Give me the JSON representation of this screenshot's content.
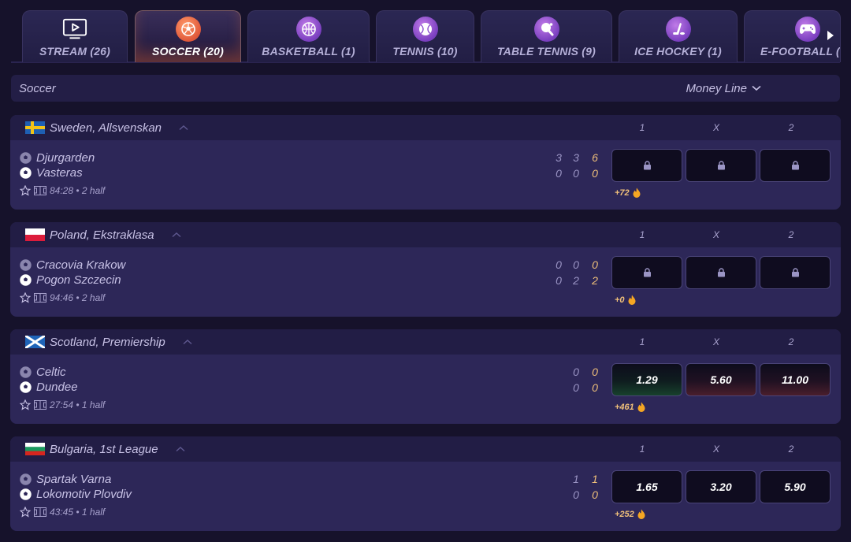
{
  "tabs": [
    {
      "label": "STREAM (26)",
      "icon": "stream-icon",
      "active": false
    },
    {
      "label": "SOCCER (20)",
      "icon": "soccer-ball-icon",
      "active": true
    },
    {
      "label": "BASKETBALL (1)",
      "icon": "basketball-icon",
      "active": false
    },
    {
      "label": "TENNIS (10)",
      "icon": "tennis-ball-icon",
      "active": false
    },
    {
      "label": "TABLE TENNIS (9)",
      "icon": "table-tennis-icon",
      "active": false
    },
    {
      "label": "ICE HOCKEY (1)",
      "icon": "ice-hockey-icon",
      "active": false
    },
    {
      "label": "E-FOOTBALL (",
      "icon": "gamepad-icon",
      "active": false
    }
  ],
  "section": {
    "title": "Soccer",
    "market": "Money Line"
  },
  "odds_headers": [
    "1",
    "X",
    "2"
  ],
  "leagues": [
    {
      "name": "Sweden, Allsvenskan",
      "flag": "sweden",
      "home": "Djurgarden",
      "away": "Vasteras",
      "home_scores": [
        "3",
        "3",
        "6"
      ],
      "away_scores": [
        "0",
        "0",
        "0"
      ],
      "time": "84:28 • 2 half",
      "odds": [
        "",
        "",
        ""
      ],
      "locked": true,
      "bets": "+72"
    },
    {
      "name": "Poland, Ekstraklasa",
      "flag": "poland",
      "home": "Cracovia Krakow",
      "away": "Pogon Szczecin",
      "home_scores": [
        "0",
        "0",
        "0"
      ],
      "away_scores": [
        "0",
        "2",
        "2"
      ],
      "time": "94:46 • 2 half",
      "odds": [
        "",
        "",
        ""
      ],
      "locked": true,
      "bets": "+0"
    },
    {
      "name": "Scotland, Premiership",
      "flag": "scotland",
      "home": "Celtic",
      "away": "Dundee",
      "home_scores": [
        "0",
        "0"
      ],
      "away_scores": [
        "0",
        "0"
      ],
      "time": "27:54 • 1 half",
      "odds": [
        "1.29",
        "5.60",
        "11.00"
      ],
      "locked": false,
      "bets": "+461"
    },
    {
      "name": "Bulgaria, 1st League",
      "flag": "bulgaria",
      "home": "Spartak Varna",
      "away": "Lokomotiv Plovdiv",
      "home_scores": [
        "1",
        "1"
      ],
      "away_scores": [
        "0",
        "0"
      ],
      "time": "43:45 • 1 half",
      "odds": [
        "1.65",
        "3.20",
        "5.90"
      ],
      "locked": false,
      "bets": "+252"
    }
  ],
  "colors": {
    "background": "#16122b",
    "card": "#2d2758",
    "header": "#221d45",
    "accent_orange": "#e0583a",
    "accent_purple": "#7a3fbf",
    "score_total": "#f0c07a",
    "odd_button": "#0f0c1f"
  }
}
